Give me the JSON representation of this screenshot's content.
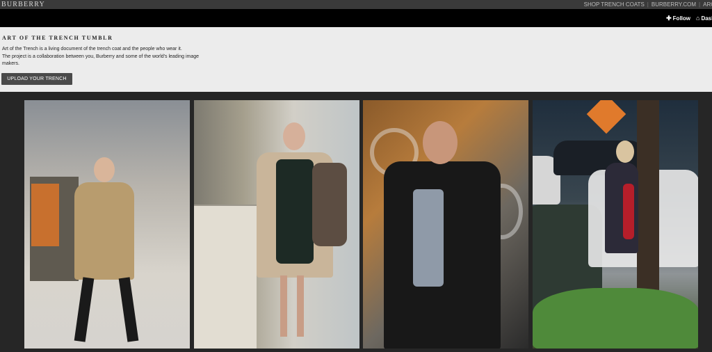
{
  "topbar": {
    "brand": "BURBERRY",
    "links": [
      "SHOP TRENCH COATS",
      "BURBERRY.COM",
      "ARC"
    ]
  },
  "tumblr_bar": {
    "follow_label": "Follow",
    "dashboard_label": "Dash"
  },
  "header": {
    "title": "ART OF THE TRENCH TUMBLR",
    "description_lines": [
      "Art of the Trench is a living document of the trench coat and the people who wear it.",
      "The project is a collaboration between you, Burberry and some of the world's leading image",
      "makers."
    ],
    "upload_label": "UPLOAD YOUR TRENCH"
  },
  "icons": {
    "follow": "plus-icon",
    "dashboard": "home-icon"
  },
  "colors": {
    "topbar_bg": "#3a3a3a",
    "tumblrbar_bg": "#000000",
    "header_bg": "#ececec",
    "button_bg": "#4a4a4a",
    "gallery_bg": "#262626"
  },
  "photos": [
    {
      "subject": "person in beige trench coat, city street"
    },
    {
      "subject": "woman in light trench coat at newsstand"
    },
    {
      "subject": "man in black trench coat with phone"
    },
    {
      "subject": "woman in navy trench coat near trees"
    }
  ]
}
